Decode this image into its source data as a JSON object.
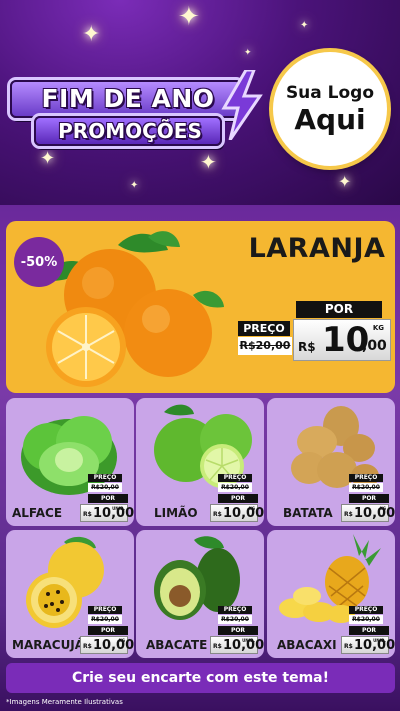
{
  "header": {
    "title_line1": "FIM DE ANO",
    "title_line2": "PROMOÇÕES",
    "logo_line1": "Sua Logo",
    "logo_line2": "Aqui"
  },
  "hero": {
    "discount": "-50%",
    "name": "LARANJA",
    "preco_label": "PREÇO",
    "por_label": "POR",
    "old_price": "R$20,00",
    "currency": "R$",
    "new_price": "10",
    "new_cents": ",00",
    "unit": "KG"
  },
  "products": [
    {
      "name": "ALFACE",
      "preco_label": "PREÇO",
      "old_price": "R$20,00",
      "por_label": "POR",
      "currency": "R$",
      "price": "10,00",
      "unit": "UNID."
    },
    {
      "name": "LIMÃO",
      "preco_label": "PREÇO",
      "old_price": "R$20,00",
      "por_label": "POR",
      "currency": "R$",
      "price": "10,00",
      "unit": "KG"
    },
    {
      "name": "BATATA",
      "preco_label": "PREÇO",
      "old_price": "R$20,00",
      "por_label": "POR",
      "currency": "R$",
      "price": "10,00",
      "unit": "KG"
    },
    {
      "name": "MARACUJÁ",
      "preco_label": "PREÇO",
      "old_price": "R$20,00",
      "por_label": "POR",
      "currency": "R$",
      "price": "10,00",
      "unit": "KG"
    },
    {
      "name": "ABACATE",
      "preco_label": "PREÇO",
      "old_price": "R$20,00",
      "por_label": "POR",
      "currency": "R$",
      "price": "10,00",
      "unit": "UNID."
    },
    {
      "name": "ABACAXI",
      "preco_label": "PREÇO",
      "old_price": "R$20,00",
      "por_label": "POR",
      "currency": "R$",
      "price": "10,00",
      "unit": "UNID."
    }
  ],
  "cta": "Crie seu encarte com este tema!",
  "footnote": "*Imagens Meramente Ilustrativas",
  "colors": {
    "hero_bg": "#f5b731",
    "card_bg": "#c9a5e8",
    "accent": "#7a2cb8",
    "discount_bg": "#7a2a9e"
  },
  "icons": [
    "sparkle-icon",
    "lightning-bolt-icon"
  ]
}
